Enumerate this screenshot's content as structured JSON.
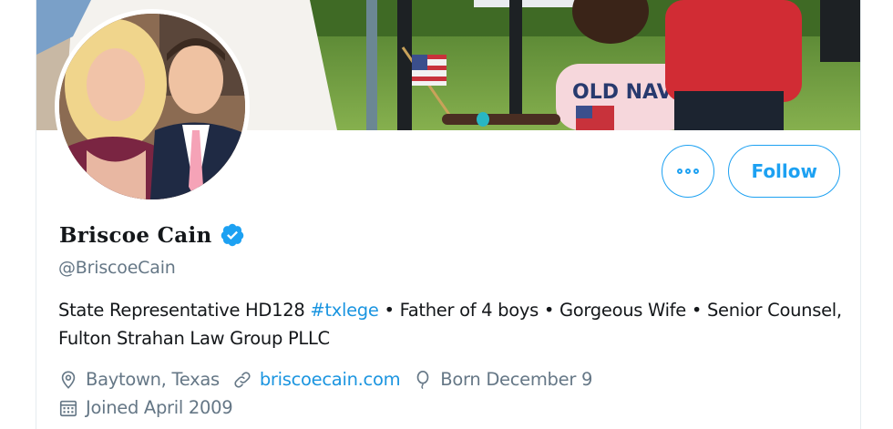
{
  "profile": {
    "name": "Briscoe Cain",
    "handle": "@BriscoeCain",
    "verified": true
  },
  "actions": {
    "more_icon": "more-dots-icon",
    "follow_label": "Follow"
  },
  "bio": {
    "part1": "State Representative HD128 ",
    "hashtag": "#txlege",
    "part2": " • Father of 4 boys • Gorgeous Wife • Senior Counsel, Fulton Strahan Law Group PLLC"
  },
  "meta": {
    "location": "Baytown, Texas",
    "website": "briscoecain.com",
    "birthday": "Born December 9",
    "joined": "Joined April 2009"
  },
  "icons": {
    "location": "location-pin-icon",
    "website": "link-icon",
    "birthday": "balloon-icon",
    "joined": "calendar-icon",
    "verified": "verified-badge-icon"
  },
  "colors": {
    "accent": "#1da1f2",
    "link": "#1b95e0",
    "text": "#14171a",
    "secondary": "#657786"
  }
}
